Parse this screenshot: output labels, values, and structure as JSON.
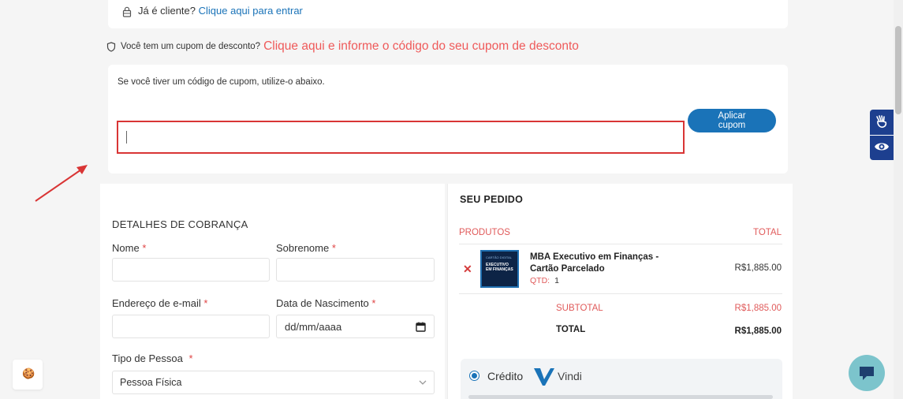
{
  "login_notice": {
    "text": "Já é cliente?",
    "link": "Clique aqui para entrar"
  },
  "coupon_notice": {
    "text": "Você tem um cupom de desconto?",
    "link": "Clique aqui e informe o código do seu cupom de desconto"
  },
  "coupon_form": {
    "hint": "Se você tiver um código de cupom, utilize-o abaixo.",
    "input_value": "",
    "apply_label_line1": "Aplicar",
    "apply_label_line2": "cupom"
  },
  "billing": {
    "title": "DETALHES DE COBRANÇA",
    "required_mark": "*",
    "first_name_label": "Nome",
    "last_name_label": "Sobrenome",
    "email_label": "Endereço de e-mail",
    "birth_label": "Data de Nascimento",
    "birth_placeholder": "dd/mm/aaaa",
    "person_type_label": "Tipo de Pessoa",
    "person_type_value": "Pessoa Física"
  },
  "order": {
    "title": "SEU PEDIDO",
    "col_products": "PRODUTOS",
    "col_total": "TOTAL",
    "product": {
      "name_line1": "MBA Executivo em Finanças -",
      "name_line2": "Cartão Parcelado",
      "qty_label": "QTD:",
      "qty": "1",
      "price": "R$1,885.00",
      "thumb_small": "CARTÃO DIGITAL",
      "thumb_line1": "EXECUTIVO",
      "thumb_line2": "EM FINANÇAS"
    },
    "subtotal_label": "SUBTOTAL",
    "subtotal_value": "R$1,885.00",
    "total_label": "TOTAL",
    "total_value": "R$1,885.00",
    "payment_method": "Crédito",
    "payment_provider": "Vindi"
  },
  "colors": {
    "accent_blue": "#1a73b8",
    "link_red": "#ef5a5a",
    "error_border": "#d93535",
    "a11y_blue": "#1d3f8f",
    "chat_teal": "#7cc4cc"
  }
}
